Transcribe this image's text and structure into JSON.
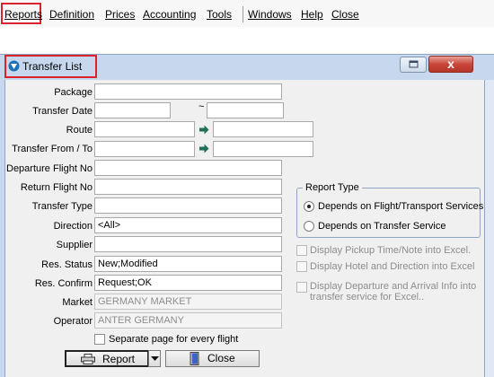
{
  "menu": {
    "items": [
      {
        "label": "Reports",
        "hotkey_index": 0
      },
      {
        "label": "Definition",
        "hotkey_index": 0
      },
      {
        "label": "Prices",
        "hotkey_index": 0
      },
      {
        "label": "Accounting",
        "hotkey_index": 0
      },
      {
        "label": "Tools",
        "hotkey_index": 0
      },
      {
        "label": "Windows",
        "hotkey_index": 0
      },
      {
        "label": "Help",
        "hotkey_index": 0
      },
      {
        "label": "Close",
        "hotkey_index": 0
      }
    ]
  },
  "window": {
    "title": "Transfer List",
    "close_glyph": "x"
  },
  "form": {
    "labels": {
      "package": "Package",
      "transfer_date": "Transfer Date",
      "route": "Route",
      "transfer_from_to": "Transfer From / To",
      "departure_flight": "Departure Flight No",
      "return_flight": "Return Flight No",
      "transfer_type": "Transfer Type",
      "direction": "Direction",
      "supplier": "Supplier",
      "res_status": "Res. Status",
      "res_confirm": "Res. Confirm",
      "market": "Market",
      "operator": "Operator"
    },
    "values": {
      "package": "",
      "transfer_date_from": "",
      "transfer_date_to": "",
      "route_from": "",
      "route_to": "",
      "transfer_from": "",
      "transfer_to": "",
      "departure_flight": "",
      "return_flight": "",
      "transfer_type": "",
      "direction": "<All>",
      "supplier": "",
      "res_status": "New;Modified",
      "res_confirm": "Request;OK",
      "market": "GERMANY MARKET",
      "operator": "ANTER GERMANY"
    },
    "date_separator": "~",
    "separate_page": "Separate page for every flight"
  },
  "report_type": {
    "title": "Report Type",
    "options": [
      {
        "label": "Depends on Flight/Transport Services",
        "selected": true
      },
      {
        "label": "Depends on Transfer Service",
        "selected": false
      }
    ]
  },
  "options": {
    "pickup_note": "Display Pickup Time/Note into Excel.",
    "hotel_direction": "Display Hotel and Direction into Excel",
    "dep_arr_line1": "Display Departure and Arrival Info into",
    "dep_arr_line2": "transfer service for Excel.."
  },
  "buttons": {
    "report": "Report",
    "close": "Close"
  },
  "colors": {
    "accent_highlight": "#d9232d",
    "window_frame": "#c7d8ee",
    "arrow_green": "#1f6f5a"
  }
}
